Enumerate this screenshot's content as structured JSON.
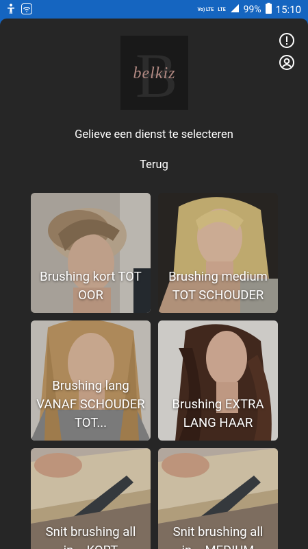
{
  "status_bar": {
    "net_top": "Vo) LTE",
    "net_lte": "LTE",
    "battery": "99%",
    "clock": "15:10"
  },
  "logo": {
    "text": "belkiz"
  },
  "header": {
    "title": "Gelieve een dienst te selecteren",
    "back_label": "Terug"
  },
  "services": [
    {
      "label": "Brushing kort TOT OOR"
    },
    {
      "label": "Brushing medium TOT SCHOUDER"
    },
    {
      "label": "Brushing lang VANAF SCHOUDER TOT..."
    },
    {
      "label": "Brushing EXTRA LANG HAAR"
    },
    {
      "label": "Snit brushing all in... KORT"
    },
    {
      "label": "Snit brushing all in... MEDIUM"
    }
  ],
  "colors": {
    "status_bar": "#1565c0",
    "sheet_background": "#262626",
    "text": "#ffffff",
    "logo_text": "#b38a83"
  }
}
